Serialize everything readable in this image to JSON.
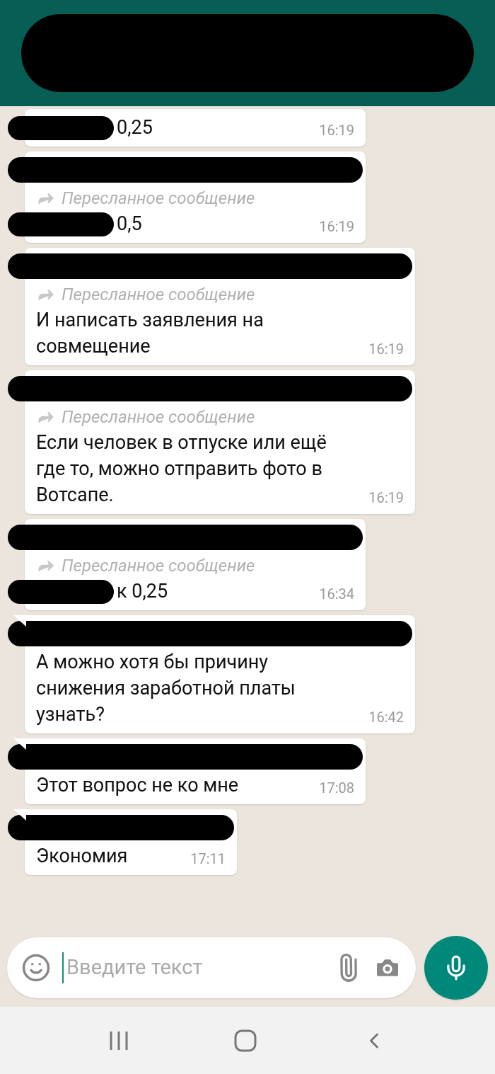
{
  "messages": [
    {
      "tail": false,
      "sender_hidden": false,
      "prefix_hidden": true,
      "text": "0,25",
      "time": "16:19"
    },
    {
      "tail": false,
      "sender_hidden": true,
      "forwarded_label": "Пересланное сообщение",
      "prefix_hidden": true,
      "text": "0,5",
      "time": "16:19"
    },
    {
      "tail": false,
      "sender_hidden": true,
      "forwarded_label": "Пересланное сообщение",
      "prefix_hidden": false,
      "text": "И написать заявления на совмещение",
      "time": "16:19"
    },
    {
      "tail": false,
      "sender_hidden": true,
      "forwarded_label": "Пересланное сообщение",
      "prefix_hidden": false,
      "text": "Если человек в отпуске или ещё где то, можно отправить фото в Вотсапе.",
      "time": "16:19"
    },
    {
      "tail": false,
      "sender_hidden": true,
      "forwarded_label": "Пересланное сообщение",
      "prefix_hidden": true,
      "text": "к 0,25",
      "time": "16:34"
    },
    {
      "tail": true,
      "sender_hidden": true,
      "prefix_hidden": false,
      "text": "А можно хотя бы причину снижения заработной платы узнать?",
      "time": "16:42"
    },
    {
      "tail": true,
      "sender_hidden": true,
      "prefix_hidden": false,
      "text": "Этот вопрос не ко мне",
      "time": "17:08"
    },
    {
      "tail": true,
      "sender_hidden": true,
      "prefix_hidden": false,
      "text": "Экономия",
      "time": "17:11"
    }
  ],
  "composer": {
    "placeholder": "Введите текст"
  }
}
